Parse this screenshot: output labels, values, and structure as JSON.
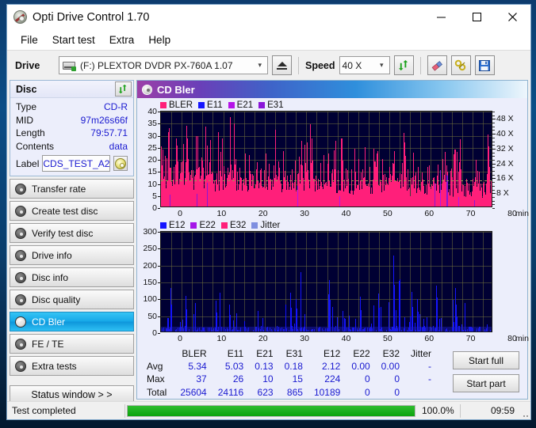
{
  "window": {
    "title": "Opti Drive Control 1.70",
    "icon": "cd-drive-icon",
    "minimize": "—",
    "maximize": "□",
    "close": "✕"
  },
  "menu": [
    "File",
    "Start test",
    "Extra",
    "Help"
  ],
  "toolbar": {
    "drive_label": "Drive",
    "drive_value": "(F:)  PLEXTOR DVDR  PX-760A 1.07",
    "eject_icon": "eject-icon",
    "speed_label": "Speed",
    "speed_value": "40 X",
    "refresh_icon": "refresh-icon",
    "erase_icon": "eraser-icon",
    "tools_icon": "wrench-icon",
    "save_icon": "save-icon"
  },
  "disc": {
    "group_title": "Disc",
    "refresh_icon": "refresh-icon",
    "rows": [
      {
        "key": "Type",
        "value": "CD-R"
      },
      {
        "key": "MID",
        "value": "97m26s66f"
      },
      {
        "key": "Length",
        "value": "79:57.71"
      },
      {
        "key": "Contents",
        "value": "data"
      }
    ],
    "label_key": "Label",
    "label_value": "CDS_TEST_A2",
    "label_icon": "cd-disc-icon"
  },
  "nav": {
    "items": [
      {
        "label": "Transfer rate",
        "active": false
      },
      {
        "label": "Create test disc",
        "active": false
      },
      {
        "label": "Verify test disc",
        "active": false
      },
      {
        "label": "Drive info",
        "active": false
      },
      {
        "label": "Disc info",
        "active": false
      },
      {
        "label": "Disc quality",
        "active": false
      },
      {
        "label": "CD Bler",
        "active": true
      },
      {
        "label": "FE / TE",
        "active": false
      },
      {
        "label": "Extra tests",
        "active": false
      }
    ],
    "status_window": "Status window > >"
  },
  "panel": {
    "title": "CD Bler",
    "icon": "cd-disc-icon"
  },
  "chart_data": [
    {
      "id": "bler-chart",
      "type": "bar",
      "title": "CD Bler",
      "xlabel": "min",
      "ylabel": "",
      "xlim": [
        0,
        80
      ],
      "ylim": [
        0,
        40
      ],
      "xticks": [
        0,
        10,
        20,
        30,
        40,
        50,
        60,
        70,
        80
      ],
      "yticks": [
        0,
        5,
        10,
        15,
        20,
        25,
        30,
        35,
        40
      ],
      "right_axis": {
        "label": "X",
        "ticks": [
          "8 X",
          "16 X",
          "24 X",
          "32 X",
          "40 X",
          "48 X"
        ],
        "values": [
          8,
          16,
          24,
          32,
          40,
          48
        ],
        "lim": [
          0,
          52
        ]
      },
      "grid": true,
      "bg": "#000033",
      "legend_position": "top-left",
      "legend": [
        {
          "name": "BLER",
          "color": "#ff1f7a"
        },
        {
          "name": "E11",
          "color": "#1515ff"
        },
        {
          "name": "E21",
          "color": "#b515e8"
        },
        {
          "name": "E31",
          "color": "#8a15d8"
        }
      ],
      "series": [
        {
          "name": "BLER",
          "color": "#ff1f7a",
          "avg": 5.34,
          "max": 37,
          "total": 25604
        },
        {
          "name": "E11",
          "color": "#1515ff",
          "avg": 5.03,
          "max": 26,
          "total": 24116
        },
        {
          "name": "E21",
          "color": "#b515e8",
          "avg": 0.13,
          "max": 10,
          "total": 623
        },
        {
          "name": "E31",
          "color": "#8a15d8",
          "avg": 0.18,
          "max": 15,
          "total": 865
        }
      ],
      "speed_line": {
        "color": "#7a7a3a",
        "style": "dashed",
        "value_x": 12
      }
    },
    {
      "id": "e12-chart",
      "type": "bar",
      "title": "",
      "xlabel": "min",
      "ylabel": "",
      "xlim": [
        0,
        80
      ],
      "ylim": [
        0,
        300
      ],
      "xticks": [
        0,
        10,
        20,
        30,
        40,
        50,
        60,
        70,
        80
      ],
      "yticks": [
        0,
        50,
        100,
        150,
        200,
        250,
        300
      ],
      "grid": true,
      "bg": "#000033",
      "legend_position": "top-left",
      "legend": [
        {
          "name": "E12",
          "color": "#1515ff"
        },
        {
          "name": "E22",
          "color": "#a515e8"
        },
        {
          "name": "E32",
          "color": "#ff1f7a"
        },
        {
          "name": "Jitter",
          "color": "#7f8fe0"
        }
      ],
      "series": [
        {
          "name": "E12",
          "color": "#1515ff",
          "avg": 2.12,
          "max": 224,
          "total": 10189
        },
        {
          "name": "E22",
          "color": "#a515e8",
          "avg": 0.0,
          "max": 0,
          "total": 0
        },
        {
          "name": "E32",
          "color": "#ff1f7a",
          "avg": 0.0,
          "max": 0,
          "total": 0
        },
        {
          "name": "Jitter",
          "color": "#7f8fe0",
          "avg": "-",
          "max": "-",
          "total": ""
        }
      ]
    }
  ],
  "stats": {
    "columns": [
      "BLER",
      "E11",
      "E21",
      "E31",
      "E12",
      "E22",
      "E32",
      "Jitter"
    ],
    "rows": [
      {
        "label": "Avg",
        "values": [
          "5.34",
          "5.03",
          "0.13",
          "0.18",
          "2.12",
          "0.00",
          "0.00",
          "-"
        ]
      },
      {
        "label": "Max",
        "values": [
          "37",
          "26",
          "10",
          "15",
          "224",
          "0",
          "0",
          "-"
        ]
      },
      {
        "label": "Total",
        "values": [
          "25604",
          "24116",
          "623",
          "865",
          "10189",
          "0",
          "0",
          ""
        ]
      }
    ]
  },
  "actions": {
    "start_full": "Start full",
    "start_part": "Start part"
  },
  "statusbar": {
    "message": "Test completed",
    "progress_percent": "100.0%",
    "progress_value": 100,
    "elapsed": "09:59"
  },
  "colors": {
    "accent": "#16a8e8",
    "plot_bg": "#000033",
    "progress": "#0ca30c",
    "value_text": "#1a1ad0"
  }
}
